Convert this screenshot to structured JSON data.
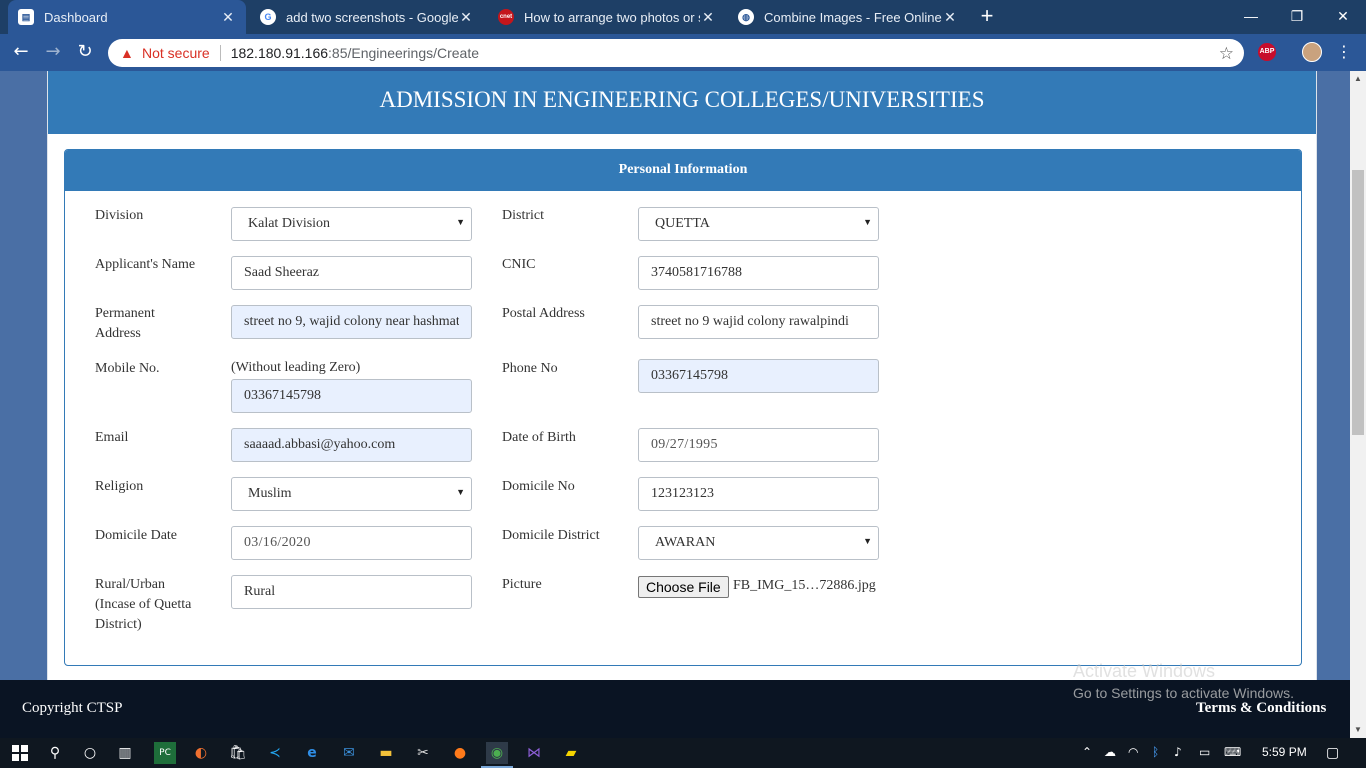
{
  "browser": {
    "tabs": [
      {
        "title": "Dashboard",
        "icon": "document-icon"
      },
      {
        "title": "add two screenshots - Google Se",
        "icon": "google-icon"
      },
      {
        "title": "How to arrange two photos or sc",
        "icon": "cnet-icon",
        "icon_text": "cnet"
      },
      {
        "title": "Combine Images - Free Online To",
        "icon": "globe-icon"
      }
    ],
    "address": {
      "security_label": "Not secure",
      "host": "182.180.91.166",
      "path": ":85/Engineerings/Create"
    },
    "extension_label": "ABP"
  },
  "page": {
    "title": "ADMISSION IN ENGINEERING COLLEGES/UNIVERSITIES",
    "panel_title": "Personal Information",
    "fields": {
      "division": {
        "label": "Division",
        "value": "Kalat Division"
      },
      "district": {
        "label": "District",
        "value": "QUETTA"
      },
      "applicant_name": {
        "label": "Applicant's Name",
        "value": "Saad Sheeraz"
      },
      "cnic": {
        "label": "CNIC",
        "value": "3740581716788"
      },
      "permanent_address": {
        "label_line1": "Permanent",
        "label_line2": "Address",
        "value": "street no 9, wajid colony near hashmat"
      },
      "postal_address": {
        "label": "Postal Address",
        "value": "street no 9 wajid colony rawalpindi"
      },
      "mobile": {
        "label": "Mobile No.",
        "hint": "(Without leading Zero)",
        "value": "03367145798"
      },
      "phone": {
        "label": "Phone No",
        "value": "03367145798"
      },
      "email": {
        "label": "Email",
        "value": "saaaad.abbasi@yahoo.com"
      },
      "dob": {
        "label": "Date of Birth",
        "value": "09/27/1995"
      },
      "religion": {
        "label": "Religion",
        "value": "Muslim"
      },
      "domicile_no": {
        "label": "Domicile No",
        "value": "123123123"
      },
      "domicile_date": {
        "label": "Domicile Date",
        "value": "03/16/2020"
      },
      "domicile_district": {
        "label": "Domicile District",
        "value": "AWARAN"
      },
      "rural_urban": {
        "label_line1": "Rural/Urban",
        "label_line2": "(Incase of Quetta",
        "label_line3": "District)",
        "value": "Rural"
      },
      "picture": {
        "label": "Picture",
        "button": "Choose File",
        "filename": "FB_IMG_15…72886.jpg"
      }
    },
    "footer": {
      "copyright": "Copyright CTSP",
      "terms": "Terms & Conditions"
    }
  },
  "watermark": {
    "line1": "Activate Windows",
    "line2": "Go to Settings to activate Windows."
  },
  "taskbar": {
    "time": "5:59 PM"
  },
  "colors": {
    "brand_blue": "#337ab7",
    "autofill": "#e8f0fe",
    "footer": "#0a1423",
    "warning_red": "#d93025"
  }
}
